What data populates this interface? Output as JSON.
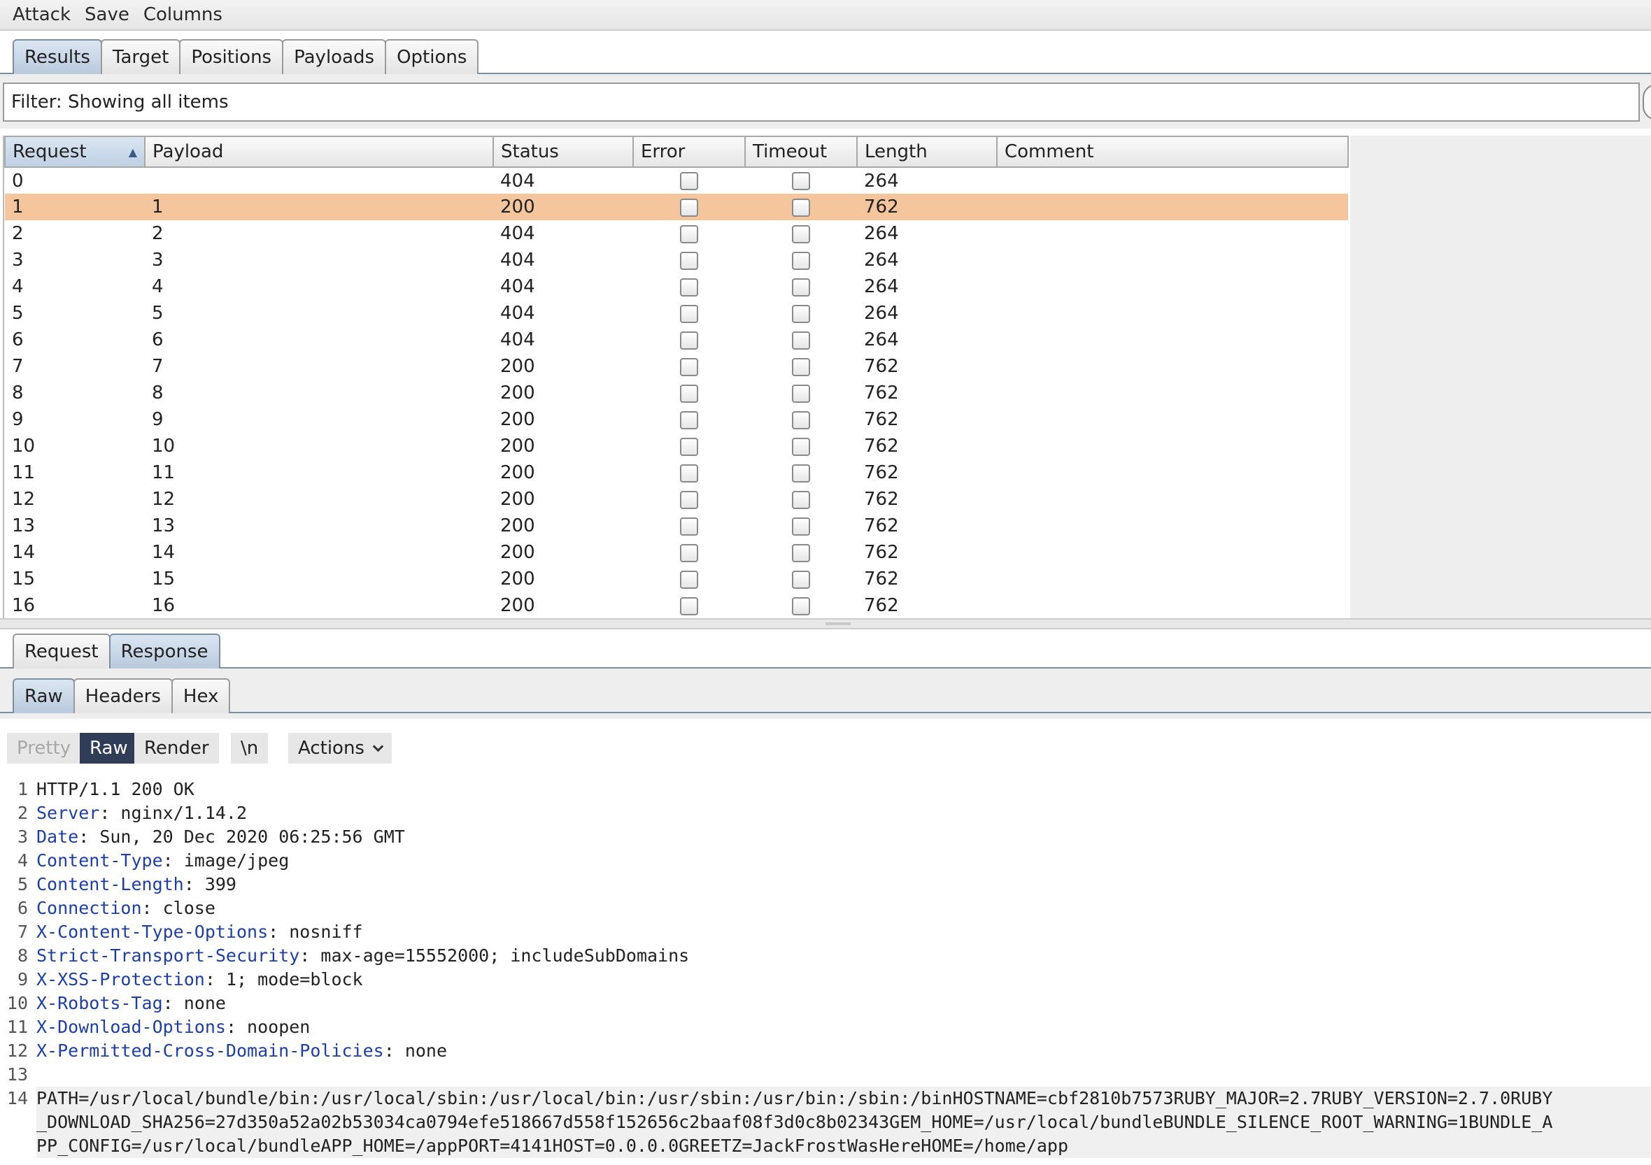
{
  "menu": {
    "items": [
      "Attack",
      "Save",
      "Columns"
    ]
  },
  "top_tabs": [
    {
      "label": "Results",
      "active": true
    },
    {
      "label": "Target",
      "active": false
    },
    {
      "label": "Positions",
      "active": false
    },
    {
      "label": "Payloads",
      "active": false
    },
    {
      "label": "Options",
      "active": false
    }
  ],
  "filter": {
    "text": "Filter: Showing all items"
  },
  "table": {
    "columns": [
      "Request",
      "Payload",
      "Status",
      "Error",
      "Timeout",
      "Length",
      "Comment"
    ],
    "sorted_column": "Request",
    "sort_indicator": "▲",
    "selected_row": 1,
    "rows": [
      {
        "request": "0",
        "payload": "",
        "status": "404",
        "length": "264"
      },
      {
        "request": "1",
        "payload": "1",
        "status": "200",
        "length": "762"
      },
      {
        "request": "2",
        "payload": "2",
        "status": "404",
        "length": "264"
      },
      {
        "request": "3",
        "payload": "3",
        "status": "404",
        "length": "264"
      },
      {
        "request": "4",
        "payload": "4",
        "status": "404",
        "length": "264"
      },
      {
        "request": "5",
        "payload": "5",
        "status": "404",
        "length": "264"
      },
      {
        "request": "6",
        "payload": "6",
        "status": "404",
        "length": "264"
      },
      {
        "request": "7",
        "payload": "7",
        "status": "200",
        "length": "762"
      },
      {
        "request": "8",
        "payload": "8",
        "status": "200",
        "length": "762"
      },
      {
        "request": "9",
        "payload": "9",
        "status": "200",
        "length": "762"
      },
      {
        "request": "10",
        "payload": "10",
        "status": "200",
        "length": "762"
      },
      {
        "request": "11",
        "payload": "11",
        "status": "200",
        "length": "762"
      },
      {
        "request": "12",
        "payload": "12",
        "status": "200",
        "length": "762"
      },
      {
        "request": "13",
        "payload": "13",
        "status": "200",
        "length": "762"
      },
      {
        "request": "14",
        "payload": "14",
        "status": "200",
        "length": "762"
      },
      {
        "request": "15",
        "payload": "15",
        "status": "200",
        "length": "762"
      },
      {
        "request": "16",
        "payload": "16",
        "status": "200",
        "length": "762"
      }
    ]
  },
  "reqresp_tabs": [
    {
      "label": "Request",
      "active": false
    },
    {
      "label": "Response",
      "active": true
    }
  ],
  "view_tabs": [
    {
      "label": "Raw",
      "active": true
    },
    {
      "label": "Headers",
      "active": false
    },
    {
      "label": "Hex",
      "active": false
    }
  ],
  "editor_toolbar": {
    "pretty": "Pretty",
    "raw": "Raw",
    "render": "Render",
    "newline": "\\n",
    "actions": "Actions"
  },
  "response": {
    "status_line": "HTTP/1.1 200 OK",
    "headers": [
      {
        "name": "Server",
        "value": "nginx/1.14.2"
      },
      {
        "name": "Date",
        "value": "Sun, 20 Dec 2020 06:25:56 GMT"
      },
      {
        "name": "Content-Type",
        "value": "image/jpeg"
      },
      {
        "name": "Content-Length",
        "value": "399"
      },
      {
        "name": "Connection",
        "value": "close"
      },
      {
        "name": "X-Content-Type-Options",
        "value": "nosniff"
      },
      {
        "name": "Strict-Transport-Security",
        "value": "max-age=15552000; includeSubDomains"
      },
      {
        "name": "X-XSS-Protection",
        "value": "1; mode=block"
      },
      {
        "name": "X-Robots-Tag",
        "value": "none"
      },
      {
        "name": "X-Download-Options",
        "value": "noopen"
      },
      {
        "name": "X-Permitted-Cross-Domain-Policies",
        "value": "none"
      }
    ],
    "body_lines": [
      "PATH=/usr/local/bundle/bin:/usr/local/sbin:/usr/local/bin:/usr/sbin:/usr/bin:/sbin:/binHOSTNAME=cbf2810b7573RUBY_MAJOR=2.7RUBY_VERSION=2.7.0RUBY",
      "_DOWNLOAD_SHA256=27d350a52a02b53034ca0794efe518667d558f152656c2baaf08f3d0c8b02343GEM_HOME=/usr/local/bundleBUNDLE_SILENCE_ROOT_WARNING=1BUNDLE_A",
      "PP_CONFIG=/usr/local/bundleAPP_HOME=/appPORT=4141HOST=0.0.0.0GREETZ=JackFrostWasHereHOME=/home/app"
    ]
  }
}
